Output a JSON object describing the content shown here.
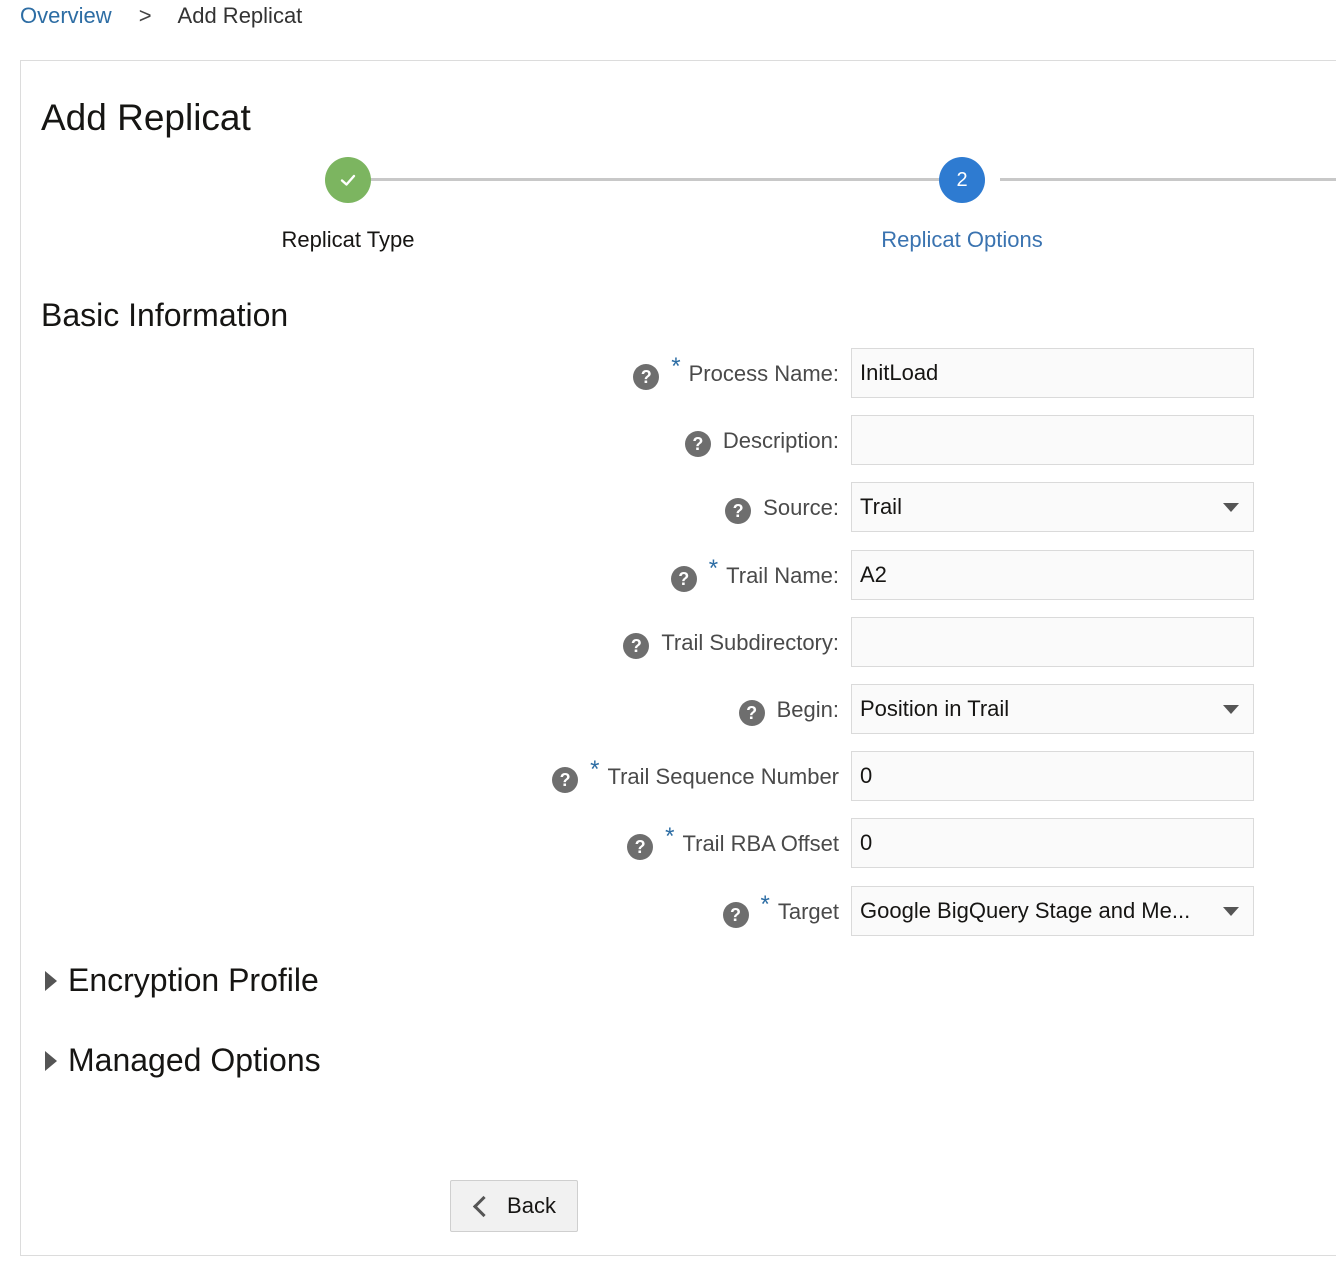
{
  "breadcrumb": {
    "link": "Overview",
    "separator": ">",
    "current": "Add Replicat"
  },
  "page": {
    "title": "Add Replicat"
  },
  "train": {
    "steps": [
      {
        "label": "Replicat Type",
        "state": "done",
        "icon": "check-icon"
      },
      {
        "label": "Replicat Options",
        "state": "current",
        "number": "2"
      }
    ]
  },
  "basic_info": {
    "title": "Basic Information",
    "fields": [
      {
        "label": "Process Name:",
        "required": true,
        "value": "InitLoad",
        "type": "text"
      },
      {
        "label": "Description:",
        "required": false,
        "value": "",
        "type": "text"
      },
      {
        "label": "Source:",
        "required": false,
        "value": "Trail",
        "type": "select"
      },
      {
        "label": "Trail Name:",
        "required": true,
        "value": "A2",
        "type": "text"
      },
      {
        "label": "Trail Subdirectory:",
        "required": false,
        "value": "",
        "type": "text"
      },
      {
        "label": "Begin:",
        "required": false,
        "value": "Position in Trail",
        "type": "select"
      },
      {
        "label": "Trail Sequence Number",
        "required": true,
        "value": "0",
        "type": "text"
      },
      {
        "label": "Trail RBA Offset",
        "required": true,
        "value": "0",
        "type": "text"
      },
      {
        "label": "Target",
        "required": true,
        "value": "Google BigQuery Stage and Me...",
        "type": "select"
      }
    ],
    "help_glyph": "?",
    "required_glyph": "*"
  },
  "sections": {
    "encryption": "Encryption Profile",
    "managed": "Managed Options"
  },
  "buttons": {
    "back": "Back"
  },
  "colors": {
    "accent": "#2d6da4",
    "step_done": "#7cb560",
    "step_current": "#2e7bd1"
  }
}
